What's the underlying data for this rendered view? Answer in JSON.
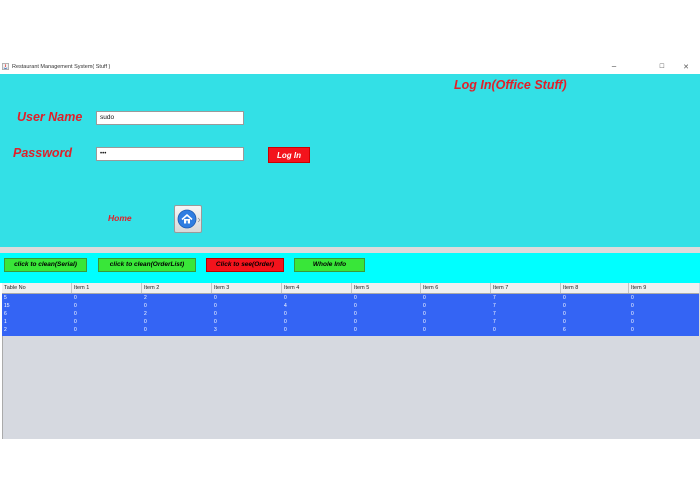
{
  "window": {
    "title": "Restaurant Management System( Stuff )",
    "controls": {
      "minimize": "─",
      "maximize": "☐",
      "close": "✕"
    }
  },
  "login": {
    "heading": "Log In(Office Stuff)",
    "username_label": "User Name",
    "username_value": "sudo",
    "password_label": "Password",
    "password_value": "•••",
    "login_button": "Log In",
    "home_label": "Home",
    "home_icon": "home-icon"
  },
  "actions": {
    "clean_serial": "click to clean(Serial)",
    "clean_orderlist": "click to clean(OrderList)",
    "see_order": "Click to see(Order)",
    "whole_info": "Whole Info"
  },
  "colors": {
    "panel": "#33e0e6",
    "action_bar": "#00ffff",
    "accent_red": "#f3131c",
    "green": "#39e639",
    "selection_blue": "#3464f4"
  },
  "table": {
    "columns": [
      "Table No",
      "Item 1",
      "Item 2",
      "Item 3",
      "Item 4",
      "Item 5",
      "Item 6",
      "Item 7",
      "Item 8",
      "Item 9"
    ],
    "rows": [
      [
        "5",
        "0",
        "2",
        "0",
        "0",
        "0",
        "0",
        "7",
        "0",
        "0"
      ],
      [
        "15",
        "0",
        "0",
        "0",
        "4",
        "0",
        "0",
        "7",
        "0",
        "0"
      ],
      [
        "6",
        "0",
        "2",
        "0",
        "0",
        "0",
        "0",
        "7",
        "0",
        "0"
      ],
      [
        "1",
        "0",
        "0",
        "0",
        "0",
        "0",
        "0",
        "7",
        "0",
        "0"
      ],
      [
        "2",
        "0",
        "0",
        "3",
        "0",
        "0",
        "0",
        "0",
        "6",
        "0"
      ]
    ]
  }
}
